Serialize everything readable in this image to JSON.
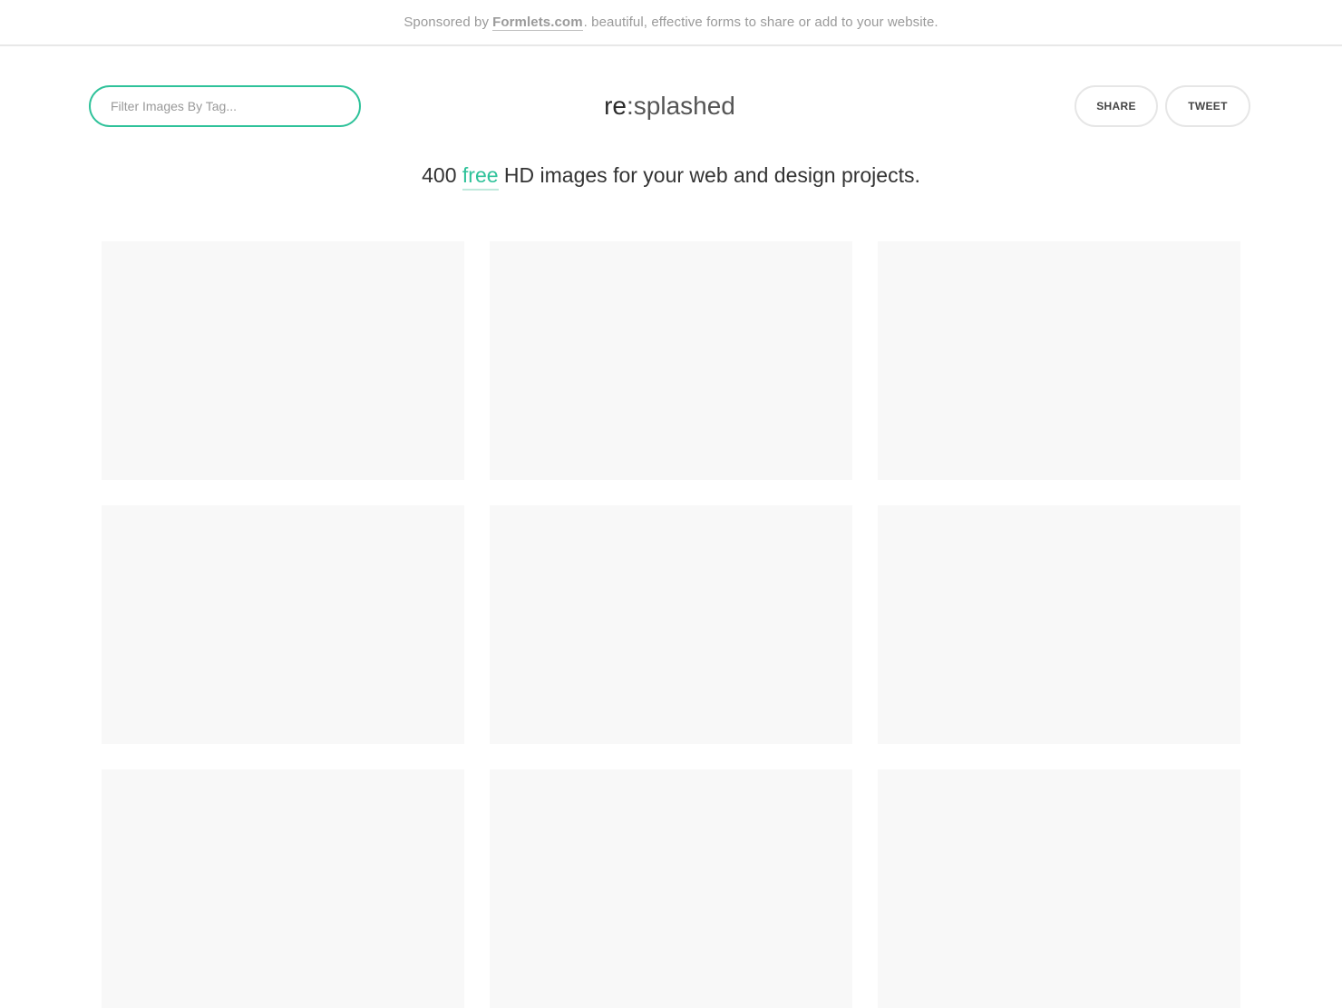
{
  "sponsor": {
    "prefix": "Sponsored by",
    "link_text": "Formlets.com",
    "suffix": ". beautiful, effective forms to share or add to your website."
  },
  "search": {
    "placeholder": "Filter Images By Tag...",
    "value": ""
  },
  "logo": {
    "re": "re",
    "rest": ":splashed"
  },
  "social": {
    "share_label": "SHARE",
    "tweet_label": "TWEET"
  },
  "tagline": {
    "count": "400",
    "free": "free",
    "rest": "HD images for your web and design projects."
  },
  "colors": {
    "accent": "#2fc29a",
    "tile_placeholder": "#f8f8f8",
    "border": "#e6e6e6"
  },
  "grid": {
    "tiles": 9
  }
}
